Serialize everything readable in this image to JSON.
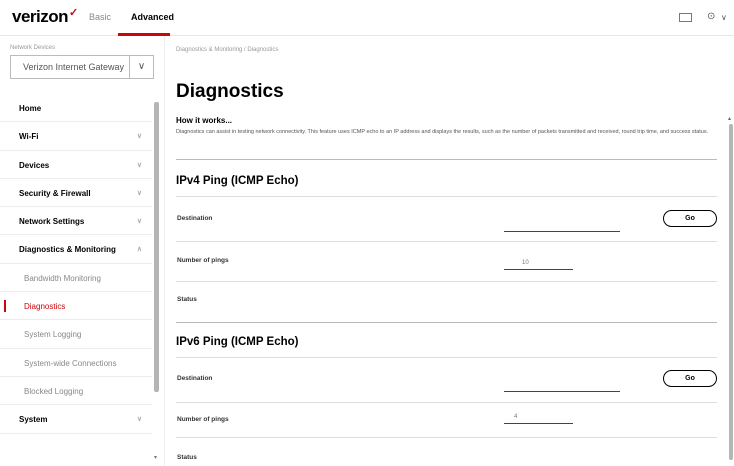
{
  "header": {
    "logo": "verizon",
    "tabs": [
      {
        "label": "Basic"
      },
      {
        "label": "Advanced"
      }
    ],
    "icons": [
      "mail-icon",
      "user-icon"
    ]
  },
  "sidebar": {
    "device_label": "Network Devices",
    "device_select_value": "Verizon Internet Gateway",
    "items": [
      {
        "label": "Home"
      },
      {
        "label": "Wi-Fi"
      },
      {
        "label": "Devices"
      },
      {
        "label": "Security & Firewall"
      },
      {
        "label": "Network Settings"
      },
      {
        "label": "Diagnostics & Monitoring"
      },
      {
        "label": "Bandwidth Monitoring"
      },
      {
        "label": "Diagnostics"
      },
      {
        "label": "System Logging"
      },
      {
        "label": "System-wide Connections"
      },
      {
        "label": "Blocked Logging"
      },
      {
        "label": "System"
      }
    ]
  },
  "main": {
    "breadcrumb": "Diagnostics & Monitoring  /  Diagnostics",
    "title": "Diagnostics",
    "how_title": "How it works...",
    "how_text": "Diagnostics can assist in testing network connectivity. This feature uses ICMP echo to an IP address and displays the results, such as the number of packets transmitted and received, round trip time, and success status.",
    "ipv4": {
      "title": "IPv4 Ping (ICMP Echo)",
      "destination_label": "Destination",
      "destination_value": "",
      "go_label": "Go",
      "pings_label": "Number of pings",
      "pings_value": "10",
      "status_label": "Status"
    },
    "ipv6": {
      "title": "IPv6 Ping (ICMP Echo)",
      "destination_label": "Destination",
      "destination_value": "",
      "go_label": "Go",
      "pings_label": "Number of pings",
      "pings_value": "4",
      "status_label": "Status"
    }
  }
}
